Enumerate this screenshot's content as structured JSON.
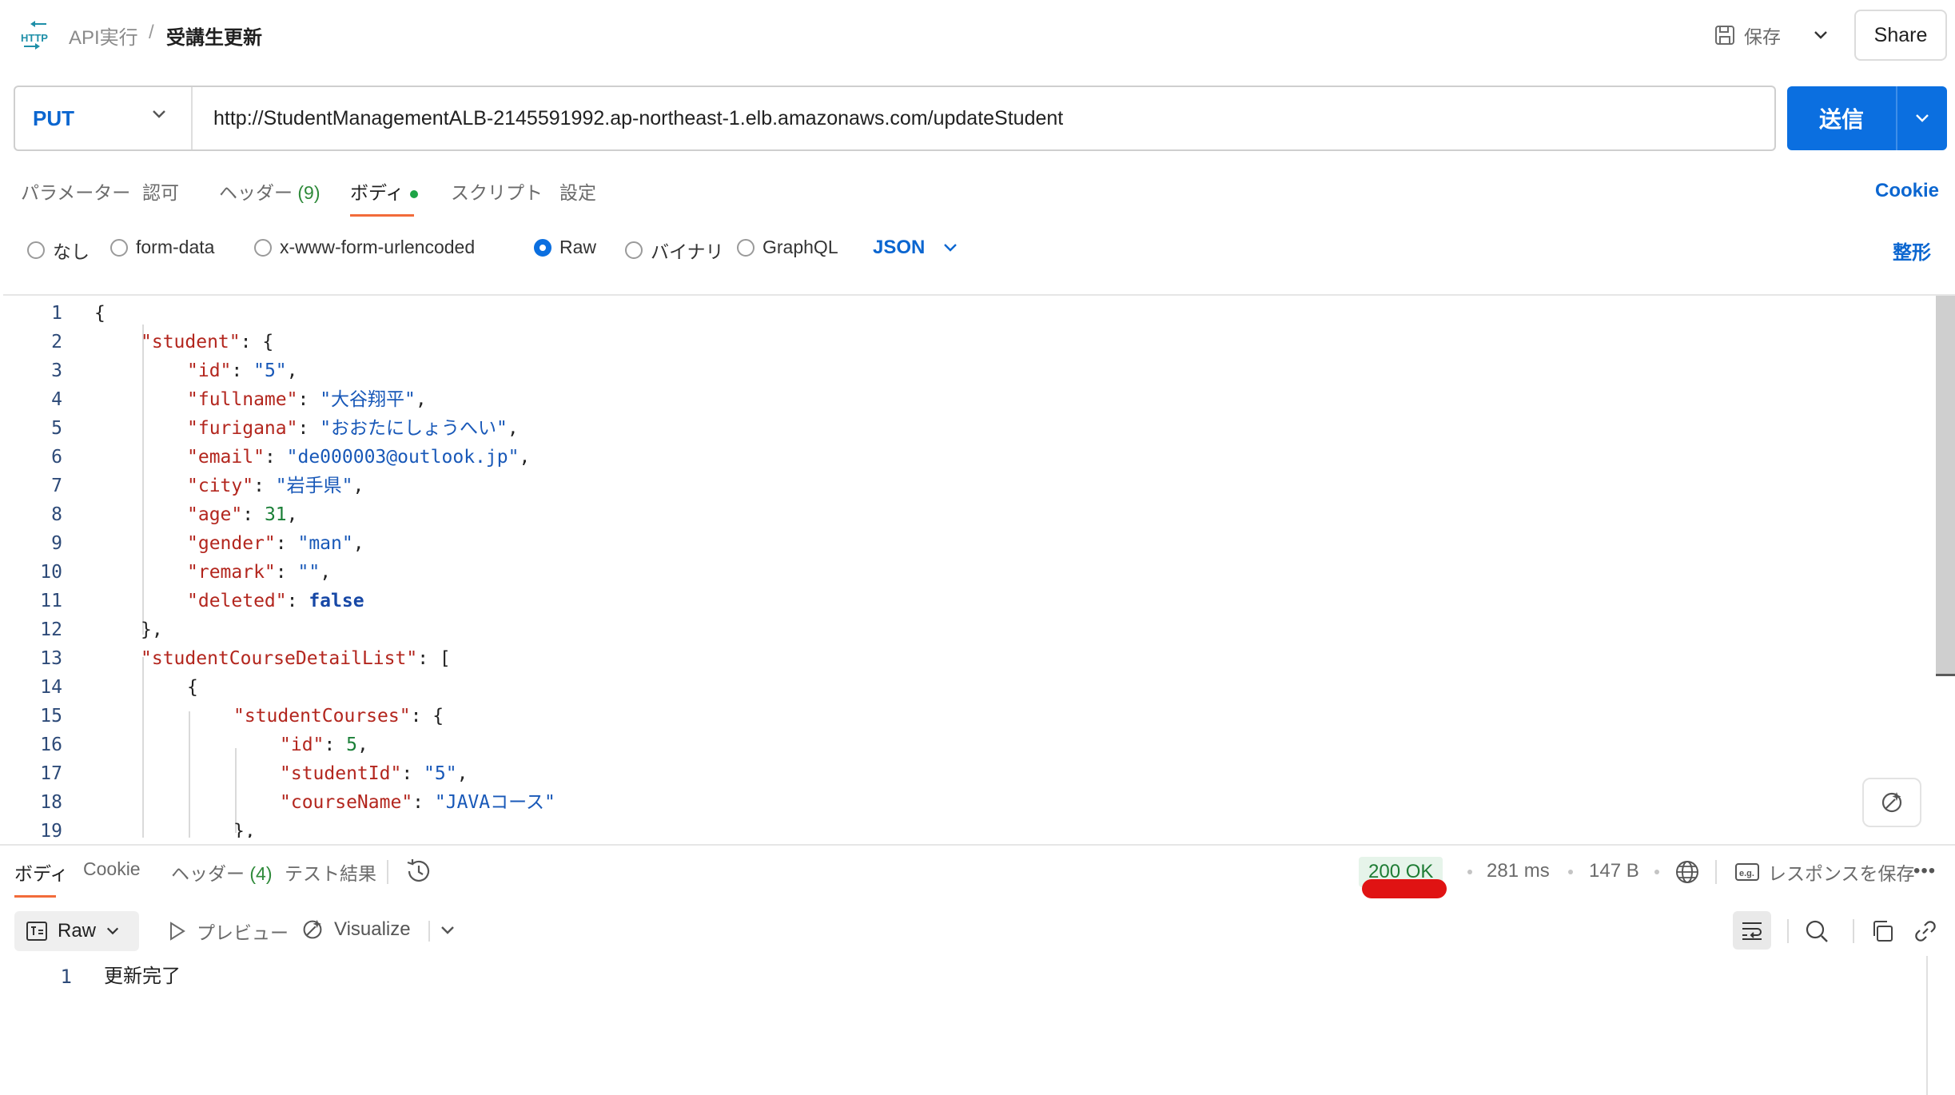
{
  "header": {
    "icon_label": "HTTP",
    "breadcrumb_parent": "API実行",
    "breadcrumb_sep": "/",
    "title": "受講生更新",
    "save_label": "保存",
    "share_label": "Share"
  },
  "request": {
    "method": "PUT",
    "url": "http://StudentManagementALB-2145591992.ap-northeast-1.elb.amazonaws.com/updateStudent",
    "send_label": "送信"
  },
  "req_tabs": [
    {
      "label": "パラメーター"
    },
    {
      "label": "認可"
    },
    {
      "label": "ヘッダー",
      "count": "(9)"
    },
    {
      "label": "ボディ"
    },
    {
      "label": "スクリプト"
    },
    {
      "label": "設定"
    }
  ],
  "cookie_label": "Cookie",
  "body_types": [
    {
      "label": "なし",
      "checked": false
    },
    {
      "label": "form-data",
      "checked": false
    },
    {
      "label": "x-www-form-urlencoded",
      "checked": false
    },
    {
      "label": "Raw",
      "checked": true
    },
    {
      "label": "バイナリ",
      "checked": false
    },
    {
      "label": "GraphQL",
      "checked": false
    }
  ],
  "body_format": "JSON",
  "beautify_label": "整形",
  "editor": {
    "line_numbers": [
      "1",
      "2",
      "3",
      "4",
      "5",
      "6",
      "7",
      "8",
      "9",
      "10",
      "11",
      "12",
      "13",
      "14",
      "15",
      "16",
      "17",
      "18",
      "19"
    ],
    "lines": [
      [
        {
          "t": "{",
          "c": ""
        }
      ],
      [
        {
          "t": "\"student\"",
          "c": "k"
        },
        {
          "t": ": {",
          "c": ""
        }
      ],
      [
        {
          "t": "\"id\"",
          "c": "k"
        },
        {
          "t": ": ",
          "c": ""
        },
        {
          "t": "\"5\"",
          "c": "s"
        },
        {
          "t": ",",
          "c": ""
        }
      ],
      [
        {
          "t": "\"fullname\"",
          "c": "k"
        },
        {
          "t": ": ",
          "c": ""
        },
        {
          "t": "\"大谷翔平\"",
          "c": "s"
        },
        {
          "t": ",",
          "c": ""
        }
      ],
      [
        {
          "t": "\"furigana\"",
          "c": "k"
        },
        {
          "t": ": ",
          "c": ""
        },
        {
          "t": "\"おおたにしょうへい\"",
          "c": "s"
        },
        {
          "t": ",",
          "c": ""
        }
      ],
      [
        {
          "t": "\"email\"",
          "c": "k"
        },
        {
          "t": ": ",
          "c": ""
        },
        {
          "t": "\"de000003@outlook.jp\"",
          "c": "s"
        },
        {
          "t": ",",
          "c": ""
        }
      ],
      [
        {
          "t": "\"city\"",
          "c": "k"
        },
        {
          "t": ": ",
          "c": ""
        },
        {
          "t": "\"岩手県\"",
          "c": "s"
        },
        {
          "t": ",",
          "c": ""
        }
      ],
      [
        {
          "t": "\"age\"",
          "c": "k"
        },
        {
          "t": ": ",
          "c": ""
        },
        {
          "t": "31",
          "c": "n"
        },
        {
          "t": ",",
          "c": ""
        }
      ],
      [
        {
          "t": "\"gender\"",
          "c": "k"
        },
        {
          "t": ": ",
          "c": ""
        },
        {
          "t": "\"man\"",
          "c": "s"
        },
        {
          "t": ",",
          "c": ""
        }
      ],
      [
        {
          "t": "\"remark\"",
          "c": "k"
        },
        {
          "t": ": ",
          "c": ""
        },
        {
          "t": "\"\"",
          "c": "s"
        },
        {
          "t": ",",
          "c": ""
        }
      ],
      [
        {
          "t": "\"deleted\"",
          "c": "k"
        },
        {
          "t": ": ",
          "c": ""
        },
        {
          "t": "false",
          "c": "b"
        }
      ],
      [
        {
          "t": "},",
          "c": ""
        }
      ],
      [
        {
          "t": "\"studentCourseDetailList\"",
          "c": "k"
        },
        {
          "t": ": [",
          "c": ""
        }
      ],
      [
        {
          "t": "{",
          "c": ""
        }
      ],
      [
        {
          "t": "\"studentCourses\"",
          "c": "k"
        },
        {
          "t": ": {",
          "c": ""
        }
      ],
      [
        {
          "t": "\"id\"",
          "c": "k"
        },
        {
          "t": ": ",
          "c": ""
        },
        {
          "t": "5",
          "c": "n"
        },
        {
          "t": ",",
          "c": ""
        }
      ],
      [
        {
          "t": "\"studentId\"",
          "c": "k"
        },
        {
          "t": ": ",
          "c": ""
        },
        {
          "t": "\"5\"",
          "c": "s"
        },
        {
          "t": ",",
          "c": ""
        }
      ],
      [
        {
          "t": "\"courseName\"",
          "c": "k"
        },
        {
          "t": ": ",
          "c": ""
        },
        {
          "t": "\"JAVAコース\"",
          "c": "s"
        }
      ],
      [
        {
          "t": "},",
          "c": ""
        }
      ]
    ]
  },
  "response": {
    "tabs": [
      {
        "label": "ボディ"
      },
      {
        "label": "Cookie"
      },
      {
        "label": "ヘッダー",
        "count": "(4)"
      },
      {
        "label": "テスト結果"
      }
    ],
    "status": "200 OK",
    "time": "281 ms",
    "size": "147 B",
    "save_label": "レスポンスを保存",
    "view_mode": "Raw",
    "preview_label": "プレビュー",
    "visualize_label": "Visualize",
    "line_number": "1",
    "body": "更新完了"
  }
}
